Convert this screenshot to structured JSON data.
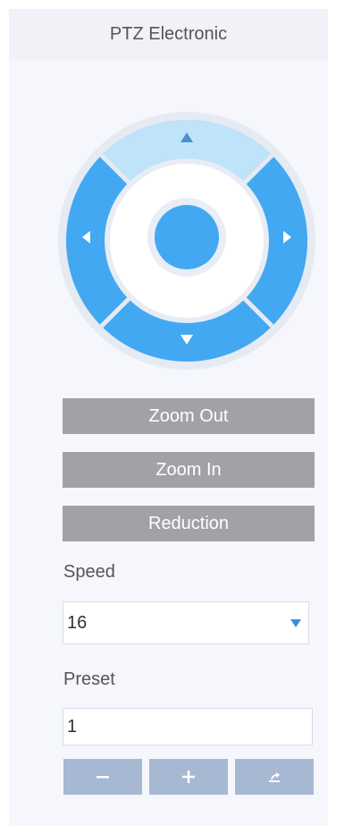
{
  "header": {
    "title": "PTZ Electronic"
  },
  "controls": {
    "zoom_out_label": "Zoom Out",
    "zoom_in_label": "Zoom In",
    "reduction_label": "Reduction"
  },
  "speed": {
    "label": "Speed",
    "value": "16"
  },
  "preset": {
    "label": "Preset",
    "value": "1"
  },
  "icons": {
    "wheel_up": "arrow-up-icon",
    "wheel_down": "arrow-down-icon",
    "wheel_left": "arrow-left-icon",
    "wheel_right": "arrow-right-icon",
    "preset_remove": "minus-icon",
    "preset_add": "plus-icon",
    "preset_call": "share-icon"
  },
  "colors": {
    "wheel_blue": "#42a8f2",
    "wheel_up_segment": "#bfe3f8",
    "center_button": "#42a8f2",
    "button_gray": "#a3a1a8",
    "preset_button": "#a7b8d3",
    "caret": "#3b8fd8"
  }
}
